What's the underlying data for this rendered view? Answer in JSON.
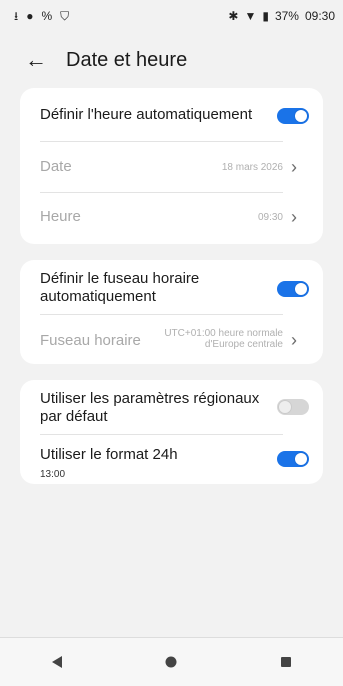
{
  "status_bar": {
    "left_icons": [
      "upload-icon",
      "cloud-icon",
      "link-icon",
      "shield-icon"
    ],
    "time": "09:30",
    "battery": "37%",
    "right_icons": [
      "bluetooth-icon",
      "wifi-icon",
      "battery-icon"
    ]
  },
  "header": {
    "title": "Date et heure"
  },
  "section1": {
    "auto_time": {
      "label": "Définir l'heure automatiquement",
      "enabled": true
    },
    "date": {
      "label": "Date",
      "value": "18 mars 2026"
    },
    "time": {
      "label": "Heure",
      "value": "09:30"
    }
  },
  "section2": {
    "auto_timezone": {
      "label_line1": "Définir le fuseau horaire",
      "label_line2": "automatiquement",
      "enabled": true
    },
    "timezone": {
      "label": "Fuseau horaire",
      "value_line1": "UTC+01:00 heure normale",
      "value_line2": "d'Europe centrale"
    }
  },
  "section3": {
    "regional": {
      "label_line1": "Utiliser les paramètres régionaux",
      "label_line2": "par défaut",
      "enabled": false
    },
    "format24": {
      "label": "Utiliser le format 24h",
      "example": "13:00",
      "enabled": true
    }
  },
  "nav": {
    "icons": [
      "back-triangle-icon",
      "home-circle-icon",
      "recents-square-icon"
    ]
  }
}
